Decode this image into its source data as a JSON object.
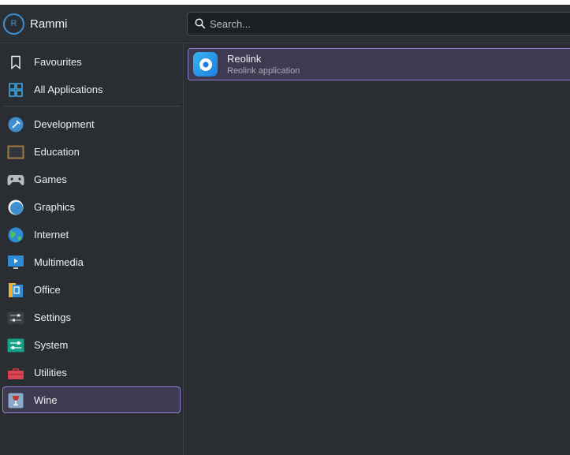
{
  "header": {
    "user": {
      "initial": "R",
      "name": "Rammi"
    },
    "search": {
      "placeholder": "Search...",
      "value": "",
      "icon": "search-icon"
    }
  },
  "sidebar": {
    "items": [
      {
        "label": "Favourites",
        "icon": "bookmark-icon",
        "selected": false
      },
      {
        "label": "All Applications",
        "icon": "grid-icon",
        "selected": false
      },
      {
        "label": "Development",
        "icon": "development-icon",
        "selected": false
      },
      {
        "label": "Education",
        "icon": "chalkboard-icon",
        "selected": false
      },
      {
        "label": "Games",
        "icon": "gamepad-icon",
        "selected": false
      },
      {
        "label": "Graphics",
        "icon": "graphics-icon",
        "selected": false
      },
      {
        "label": "Internet",
        "icon": "globe-icon",
        "selected": false
      },
      {
        "label": "Multimedia",
        "icon": "monitor-play-icon",
        "selected": false
      },
      {
        "label": "Office",
        "icon": "office-icon",
        "selected": false
      },
      {
        "label": "Settings",
        "icon": "settings-sliders-icon",
        "selected": false
      },
      {
        "label": "System",
        "icon": "system-icon",
        "selected": false
      },
      {
        "label": "Utilities",
        "icon": "toolbox-icon",
        "selected": false
      },
      {
        "label": "Wine",
        "icon": "wine-glass-icon",
        "selected": true
      }
    ]
  },
  "results": [
    {
      "name": "Reolink",
      "description": "Reolink application",
      "icon": "reolink-app-icon"
    }
  ],
  "colors": {
    "background": "#2a2e32",
    "highlight": "#3e3a52",
    "highlight_border": "#8f7fd1",
    "accent": "#3d8fd1"
  }
}
